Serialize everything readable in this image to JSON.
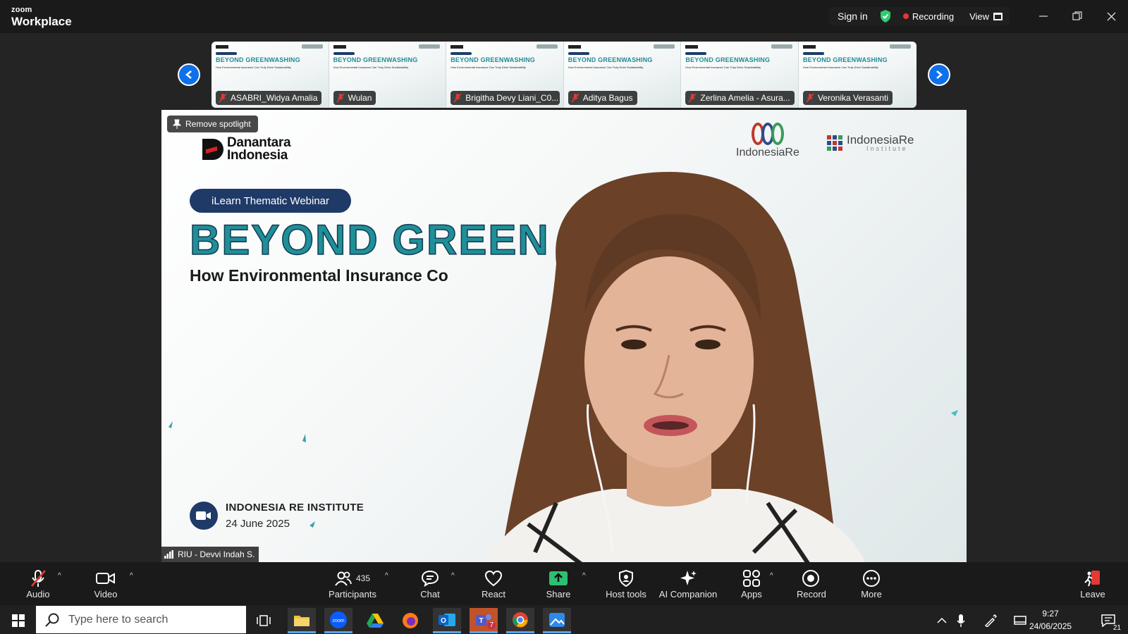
{
  "app": {
    "brand_top": "zoom",
    "brand_bottom": "Workplace",
    "sign_in": "Sign in",
    "recording": "Recording",
    "view": "View"
  },
  "gallery": {
    "thumbnail_slide_title": "BEYOND GREENWASHING",
    "thumbnail_slide_subtitle": "How Environmental Insurance Can Truly Drive Sustainability",
    "participants": [
      {
        "name": "ASABRI_Widya Amalia"
      },
      {
        "name": "Wulan"
      },
      {
        "name": "Brigitha Devy Liani_C0..."
      },
      {
        "name": "Aditya Bagus"
      },
      {
        "name": "Zerlina Amelia - Asura..."
      },
      {
        "name": "Veronika Verasanti"
      }
    ]
  },
  "spotlight": {
    "remove_label": "Remove spotlight",
    "speaker_name": "RIU - Devvi Indah S.",
    "slide": {
      "logo_left_line1": "Danantara",
      "logo_left_line2": "Indonesia",
      "logo_right1": "IndonesiaRe",
      "logo_right2_line1": "IndonesiaRe",
      "logo_right2_line2": "Institute",
      "pill": "iLearn Thematic Webinar",
      "title_visible": "BEYOND GREEN",
      "subtitle_visible": "How Environmental Insurance Co",
      "org": "INDONESIA RE INSTITUTE",
      "date": "24 June 2025"
    },
    "colors": {
      "title": "#1f8f98",
      "pill": "#1f3a67",
      "ring_red": "#c0392b",
      "ring_blue": "#2e4a8c",
      "ring_green": "#3a9a5b"
    }
  },
  "toolbar": {
    "audio": "Audio",
    "video": "Video",
    "participants_count": "435",
    "participants": "Participants",
    "chat": "Chat",
    "react": "React",
    "share": "Share",
    "host_tools": "Host tools",
    "ai_companion": "AI Companion",
    "apps": "Apps",
    "record": "Record",
    "more": "More",
    "leave": "Leave"
  },
  "taskbar": {
    "search_placeholder": "Type here to search",
    "time": "9:27",
    "date": "24/06/2025",
    "notification_count": "21",
    "teams_badge": "7"
  }
}
